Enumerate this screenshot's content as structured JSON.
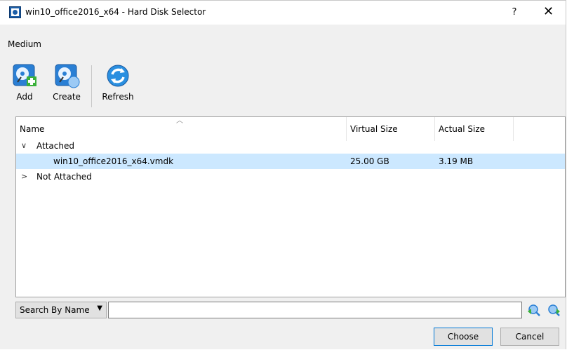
{
  "window": {
    "title": "win10_office2016_x64 - Hard Disk Selector",
    "help_label": "?",
    "close_label": "✕"
  },
  "menu": {
    "medium_label": "Medium"
  },
  "toolbar": {
    "add_label": "Add",
    "create_label": "Create",
    "refresh_label": "Refresh"
  },
  "table": {
    "columns": {
      "name": "Name",
      "virtual_size": "Virtual Size",
      "actual_size": "Actual Size"
    },
    "groups": [
      {
        "label": "Attached",
        "expanded": true,
        "items": [
          {
            "name": "win10_office2016_x64.vmdk",
            "virtual_size": "25.00 GB",
            "actual_size": "3.19 MB",
            "selected": true
          }
        ]
      },
      {
        "label": "Not Attached",
        "expanded": false,
        "items": []
      }
    ]
  },
  "search": {
    "mode_label": "Search By Name",
    "value": ""
  },
  "buttons": {
    "choose_label": "Choose",
    "cancel_label": "Cancel"
  },
  "colors": {
    "selection": "#cce8ff",
    "accent": "#0078d7",
    "icon_blue": "#2a7fd4",
    "icon_green": "#3ab13a"
  }
}
